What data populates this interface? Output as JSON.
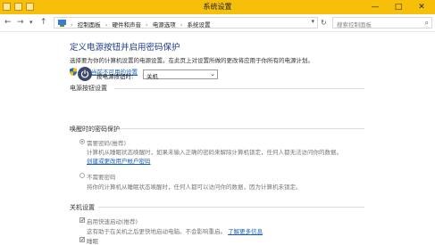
{
  "window": {
    "title": "系统设置",
    "controls": {
      "minimize": "—",
      "maximize": "□",
      "close": "✕"
    }
  },
  "nav": {
    "back": "←",
    "forward": "→",
    "up": "↑",
    "refresh": "↻",
    "breadcrumbs": [
      "控制面板",
      "硬件和声音",
      "电源选项",
      "系统设置"
    ],
    "search_placeholder": "搜索控制面板"
  },
  "page": {
    "title": "定义电源按钮并启用密码保护",
    "description": "选择要为你的计算机设置的电源设置。在此页上对设置所做的更改将应用于你所有的电源计划。",
    "change_link": "更改当前不可用的设置"
  },
  "power_button": {
    "section_label": "电源按钮设置",
    "field_label": "按电源按钮时:",
    "selected": "关机"
  },
  "wake_password": {
    "section_label": "唤醒时的密码保护",
    "options": [
      {
        "label": "需要密码(推荐)",
        "description": "计算机从睡眠状态唤醒时，如果未输入正确的密码来解除计算机锁定，任何人都无法访问你的数据。",
        "link": "创建或更改用户帐户密码",
        "selected": true
      },
      {
        "label": "不需要密码",
        "description": "将你的计算机从睡眠状态唤醒时，任何人都可以访问你的数据，因为计算机未锁定。",
        "selected": false
      }
    ]
  },
  "shutdown": {
    "section_label": "关机设置",
    "fast_startup": {
      "label": "启用快速启动(推荐)",
      "checked": true,
      "description": "这有助于在关机之后更快地启动电脑。不会影响重启。",
      "link": "了解更多信息"
    },
    "sleep": {
      "label": "睡眠",
      "checked": true
    }
  },
  "colors": {
    "titlebar": "#f5bf0a",
    "heading": "#1e3e8a",
    "link": "#1a5fb4"
  }
}
